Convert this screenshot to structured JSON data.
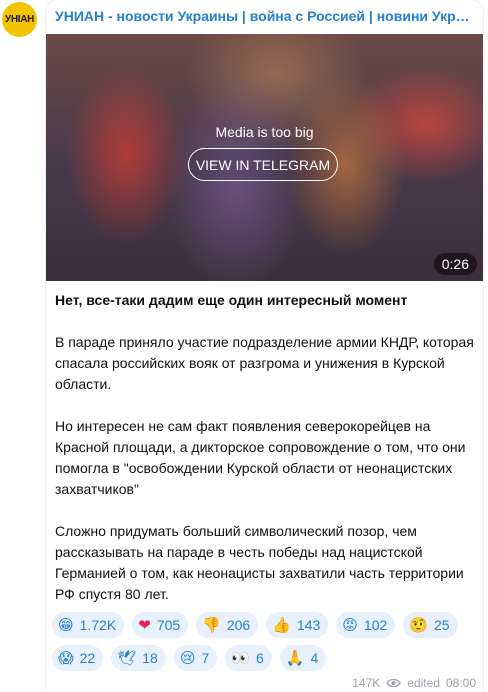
{
  "channel": {
    "avatar_text": "УНІАН",
    "title": "УНИАН - новости Украины | война с Россией | новини України | Украина"
  },
  "media": {
    "notice": "Media is too big",
    "button_label": "VIEW IN TELEGRAM",
    "duration": "0:26"
  },
  "post": {
    "headline": "Нет, все-таки дадим еще один интересный момент",
    "paragraphs": [
      "В параде приняло участие подразделение армии КНДР, которая спасала российских вояк от разгрома и унижения в Курской области.",
      "Но интересен не сам факт появления северокорейцев на Красной площади, а дикторское сопровождение о том, что они помогла в \"освобождении Курской области от неонацистских захватчиков\"",
      "Сложно придумать больший символический позор, чем рассказывать на параде в честь победы над нацистской Германией о том, как неонацисты захватили часть территории РФ спустя 80 лет."
    ]
  },
  "reactions": [
    {
      "emoji": "😁",
      "count": "1.72K"
    },
    {
      "emoji": "❤",
      "count": "705"
    },
    {
      "emoji": "👎",
      "count": "206"
    },
    {
      "emoji": "👍",
      "count": "143"
    },
    {
      "emoji": "😡",
      "count": "102"
    },
    {
      "emoji": "🤨",
      "count": "25"
    },
    {
      "emoji": "😱",
      "count": "22"
    },
    {
      "emoji": "🕊",
      "count": "18"
    },
    {
      "emoji": "😢",
      "count": "7"
    },
    {
      "emoji": "👀",
      "count": "6"
    },
    {
      "emoji": "🙏",
      "count": "4"
    }
  ],
  "meta": {
    "views": "147K",
    "edited_label": "edited",
    "time": "08:00"
  }
}
